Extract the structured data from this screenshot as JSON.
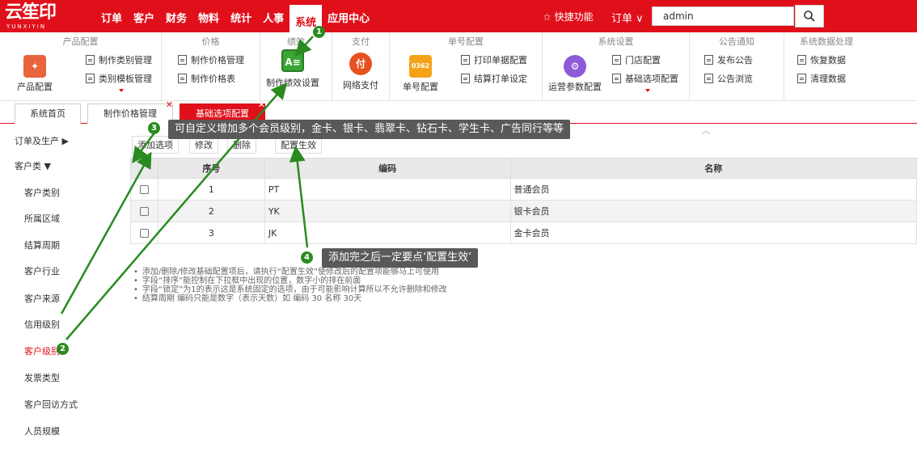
{
  "header": {
    "logo_text": "云笙印",
    "logo_sub": "YUNXIYIN",
    "nav": [
      "订单",
      "客户",
      "财务",
      "物料",
      "统计",
      "人事",
      "系统",
      "应用中心"
    ],
    "active_nav": "系统",
    "shortcut": "☆ 快捷功能",
    "order_select": "订单",
    "user": "admin",
    "search_icon": "search-icon"
  },
  "ribbon": {
    "groups": {
      "product": "产品配置",
      "price": "价格",
      "perf": "绩效",
      "pay": "支付",
      "num": "单号配置",
      "sys": "系统设置",
      "notice": "公告通知",
      "data": "系统数据处理"
    },
    "items": {
      "product_config": "产品配置",
      "cat_mgmt": "制作类别管理",
      "tpl_mgmt": "类别模板管理",
      "price_mgmt": "制作价格管理",
      "price_table": "制作价格表",
      "perf_set": "制作绩效设置",
      "net_pay": "网络支付",
      "num_config": "单号配置",
      "num_icon": "0362",
      "print_config": "打印单据配置",
      "settle_print": "结算打单设定",
      "ops_params": "运营参数配置",
      "store_config": "门店配置",
      "base_config": "基础选项配置",
      "publish": "发布公告",
      "browse": "公告浏览",
      "restore": "恢复数据",
      "clear": "清理数据"
    }
  },
  "tabs": [
    {
      "label": "系统首页"
    },
    {
      "label": "制作价格管理"
    },
    {
      "label": "基础选项配置"
    }
  ],
  "sidebar": {
    "order_cat": "订单及生产 ▶",
    "cust_cat": "客户类 ▼",
    "items": [
      "客户类别",
      "所属区域",
      "结算周期",
      "客户行业",
      "客户来源",
      "信用级别",
      "客户级别",
      "发票类型",
      "客户回访方式",
      "人员规模"
    ],
    "active": "客户级别"
  },
  "toolbar": {
    "add": "添加选项",
    "edit": "修改",
    "delete": "删除",
    "apply": "配置生效"
  },
  "table": {
    "headers": {
      "seq": "序号",
      "code": "编码",
      "name": "名称"
    },
    "rows": [
      {
        "seq": "1",
        "code": "PT",
        "name": "普通会员"
      },
      {
        "seq": "2",
        "code": "YK",
        "name": "银卡会员"
      },
      {
        "seq": "3",
        "code": "JK",
        "name": "金卡会员"
      }
    ]
  },
  "notes": [
    "添加/删除/修改基础配置项后，请执行“配置生效”使修改后的配置项能够马上可使用",
    "字段“排序”能控制在下拉框中出现的位置，数字小的排在前面",
    "字段“锁定”为1的表示这是系统固定的选项，由于可能影响计算所以不允许删除和修改",
    "结算周期 编码只能是数字（表示天数）如 编码 30 名称 30天"
  ],
  "annotations": {
    "b1": "1",
    "b2": "2",
    "b3": "3",
    "b4": "4",
    "tip3": "可自定义增加多个会员级别，金卡、银卡、翡翠卡、钻石卡、学生卡、广告同行等等",
    "tip4": "添加完之后一定要点‘配置生效’"
  },
  "colors": {
    "brand_red": "#e0101b",
    "annotation_green": "#2a8a1f",
    "tooltip_gray": "#595959"
  }
}
